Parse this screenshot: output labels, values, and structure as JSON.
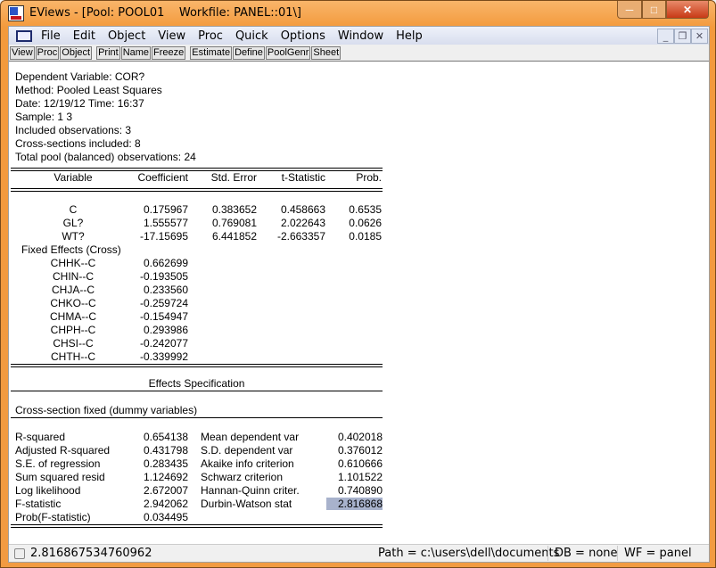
{
  "window": {
    "title": "EViews - [Pool: POOL01    Workfile: PANEL::01\\]"
  },
  "menu": [
    "File",
    "Edit",
    "Object",
    "View",
    "Proc",
    "Quick",
    "Options",
    "Window",
    "Help"
  ],
  "toolbar": [
    "View",
    "Proc",
    "Object",
    "Print",
    "Name",
    "Freeze",
    "Estimate",
    "Define",
    "PoolGenr",
    "Sheet"
  ],
  "header": [
    "Dependent Variable: COR?",
    "Method: Pooled Least Squares",
    "Date: 12/19/12   Time: 16:37",
    "Sample: 1 3",
    "Included observations: 3",
    "Cross-sections included: 8",
    "Total pool (balanced) observations: 24"
  ],
  "columns": [
    "Variable",
    "Coefficient",
    "Std. Error",
    "t-Statistic",
    "Prob."
  ],
  "rows": [
    {
      "v": "C",
      "c": "0.175967",
      "s": "0.383652",
      "t": "0.458663",
      "p": "0.6535"
    },
    {
      "v": "GL?",
      "c": "1.555577",
      "s": "0.769081",
      "t": "2.022643",
      "p": "0.0626"
    },
    {
      "v": "WT?",
      "c": "-17.15695",
      "s": "6.441852",
      "t": "-2.663357",
      "p": "0.0185"
    }
  ],
  "fixed_label": "Fixed Effects (Cross)",
  "fixed": [
    {
      "v": "CHHK--C",
      "c": "0.662699"
    },
    {
      "v": "CHIN--C",
      "c": "-0.193505"
    },
    {
      "v": "CHJA--C",
      "c": "0.233560"
    },
    {
      "v": "CHKO--C",
      "c": "-0.259724"
    },
    {
      "v": "CHMA--C",
      "c": "-0.154947"
    },
    {
      "v": "CHPH--C",
      "c": "0.293986"
    },
    {
      "v": "CHSI--C",
      "c": "-0.242077"
    },
    {
      "v": "CHTH--C",
      "c": "-0.339992"
    }
  ],
  "effects_title": "Effects Specification",
  "effects_text": "Cross-section fixed (dummy variables)",
  "stats": [
    {
      "l": "R-squared",
      "v": "0.654138",
      "l2": "Mean dependent var",
      "v2": "0.402018"
    },
    {
      "l": "Adjusted R-squared",
      "v": "0.431798",
      "l2": "S.D. dependent var",
      "v2": "0.376012"
    },
    {
      "l": "S.E. of regression",
      "v": "0.283435",
      "l2": "Akaike info criterion",
      "v2": "0.610666"
    },
    {
      "l": "Sum squared resid",
      "v": "1.124692",
      "l2": "Schwarz criterion",
      "v2": "1.101522"
    },
    {
      "l": "Log likelihood",
      "v": "2.672007",
      "l2": "Hannan-Quinn criter.",
      "v2": "0.740890"
    },
    {
      "l": "F-statistic",
      "v": "2.942062",
      "l2": "Durbin-Watson stat",
      "v2": "2.816868"
    },
    {
      "l": "Prob(F-statistic)",
      "v": "0.034495"
    }
  ],
  "status": {
    "value": "2.816867534760962",
    "path": "Path = c:\\users\\dell\\documents",
    "db": "DB = none",
    "wf": "WF = panel"
  }
}
